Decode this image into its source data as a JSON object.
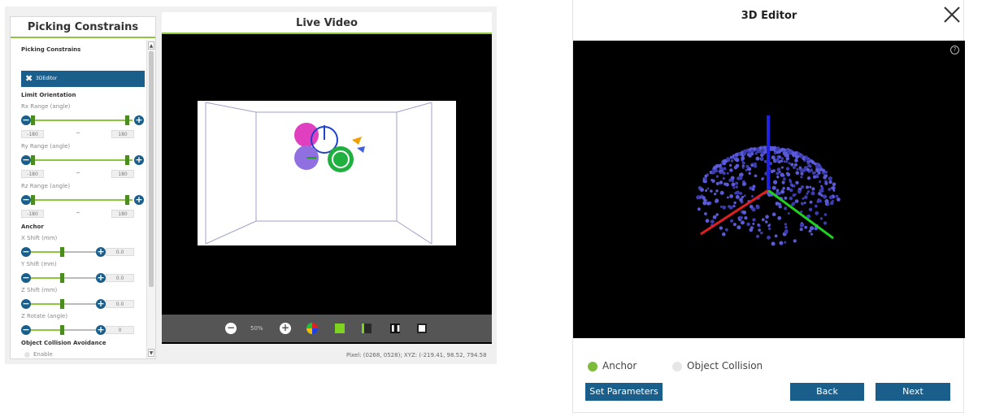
{
  "left_panel": {
    "title": "Picking Constrains",
    "section_title": "Picking Constrains",
    "editor_button": "3DEditor",
    "limit_orientation": "Limit Orientation",
    "rx": {
      "label": "Rx Range (angle)",
      "min": "-180",
      "max": "180"
    },
    "ry": {
      "label": "Ry Range (angle)",
      "min": "-180",
      "max": "180"
    },
    "rz": {
      "label": "Rz Range (angle)",
      "min": "-180",
      "max": "180"
    },
    "tilde": "~",
    "anchor_title": "Anchor",
    "x_shift": {
      "label": "X Shift (mm)",
      "value": "0.0"
    },
    "y_shift": {
      "label": "Y Shift (mm)",
      "value": "0.0"
    },
    "z_shift": {
      "label": "Z Shift (mm)",
      "value": "0.0"
    },
    "z_rotate": {
      "label": "Z Rotate (angle)",
      "value": "0"
    },
    "collision_title": "Object Collision Avoidance",
    "enable_label": "Enable"
  },
  "video": {
    "title": "Live Video",
    "zoom": "50%",
    "pixel_readout": "Pixel:  (0268, 0528);  XYZ:  (-219.41, 98.52, 794.58"
  },
  "dialog": {
    "title": "3D Editor",
    "help": "?",
    "radio_anchor": "Anchor",
    "radio_collision": "Object Collision",
    "set_parameters": "Set Parameters",
    "back": "Back",
    "next": "Next"
  },
  "colors": {
    "accent_green": "#8dc63f",
    "primary_blue": "#1a5f8c",
    "axis_x": "#e02020",
    "axis_y": "#20d020",
    "axis_z": "#2020e0"
  }
}
